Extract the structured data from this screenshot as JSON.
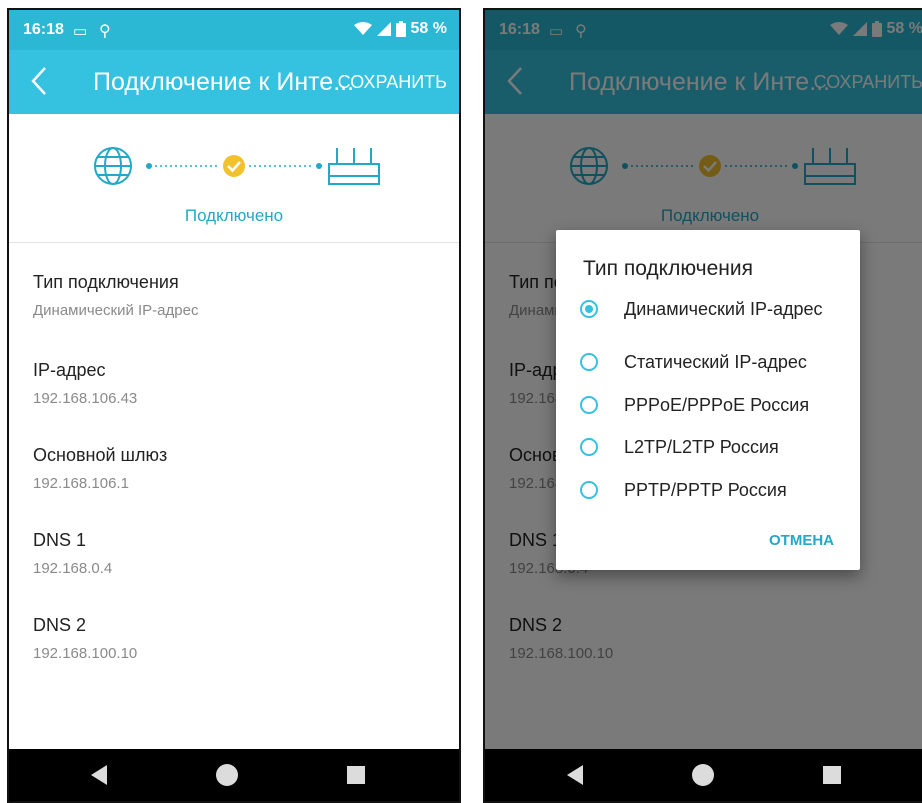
{
  "status_bar": {
    "time": "16:18",
    "battery": "58 %"
  },
  "app_bar": {
    "title": "Подключение к Инте...",
    "save_label": "СОХРАНИТЬ"
  },
  "hero": {
    "status_text": "Подключено"
  },
  "fields": [
    {
      "label": "Тип подключения",
      "value": "Динамический IP-адрес"
    },
    {
      "label": "IP-адрес",
      "value": "192.168.106.43"
    },
    {
      "label": "Основной шлюз",
      "value": "192.168.106.1"
    },
    {
      "label": "DNS 1",
      "value": "192.168.0.4"
    },
    {
      "label": "DNS 2",
      "value": "192.168.100.10"
    }
  ],
  "dialog": {
    "title": "Тип подключения",
    "options": [
      {
        "label": "Динамический IP-адрес",
        "selected": true
      },
      {
        "label": "Статический IP-адрес",
        "selected": false
      },
      {
        "label": "PPPoE/PPPoE Россия",
        "selected": false
      },
      {
        "label": "L2TP/L2TP Россия",
        "selected": false
      },
      {
        "label": "PPTP/PPTP Россия",
        "selected": false
      }
    ],
    "cancel_label": "ОТМЕНА"
  },
  "colors": {
    "accent": "#35c2e0",
    "status_bar": "#2bb8d4",
    "check_dot": "#f2c12e"
  },
  "icons": [
    "back-icon",
    "globe-icon",
    "check-icon",
    "router-icon",
    "wifi-icon",
    "signal-icon",
    "battery-icon",
    "laptop-icon",
    "usb-icon",
    "nav-back-icon",
    "nav-home-icon",
    "nav-recent-icon"
  ]
}
